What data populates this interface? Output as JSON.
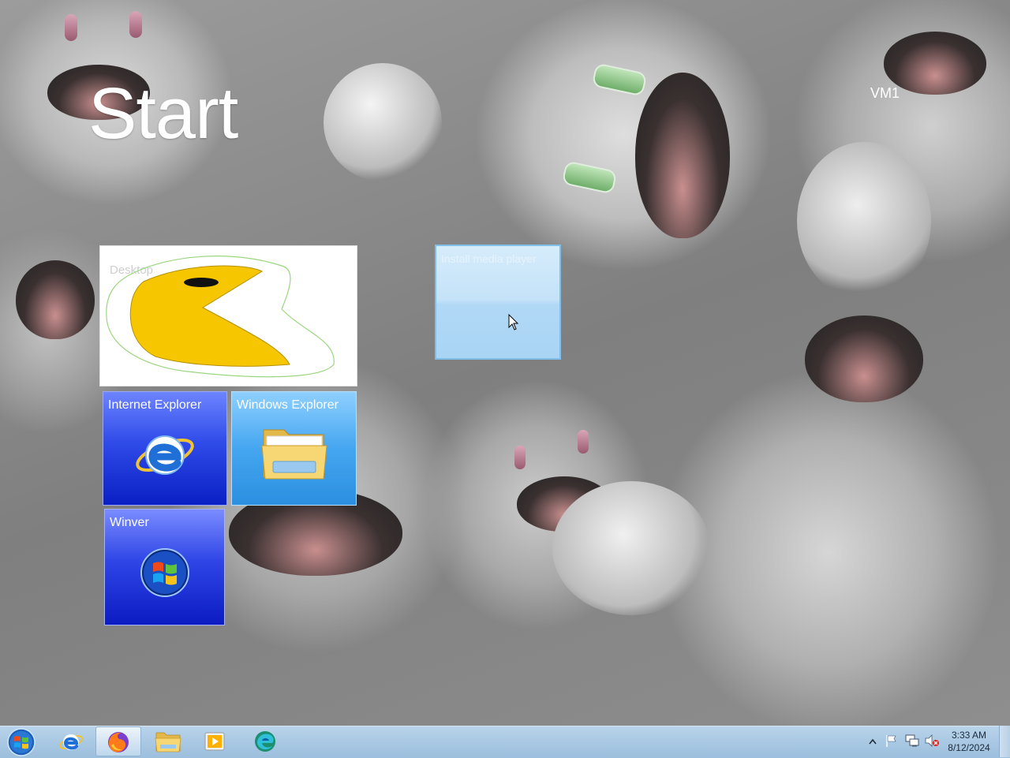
{
  "start_screen": {
    "title": "Start",
    "user_name": "VM1"
  },
  "tiles": {
    "desktop": {
      "label": "Desktop"
    },
    "internet_explorer": {
      "label": "Internet Explorer"
    },
    "windows_explorer": {
      "label": "Windows Explorer"
    },
    "winver": {
      "label": "Winver"
    },
    "placeholder": {
      "label": "Install media player"
    }
  },
  "taskbar": {
    "start_button_icon": "windows-orb-icon",
    "pinned": [
      {
        "name": "Internet Explorer",
        "icon": "ie-icon"
      },
      {
        "name": "Firefox",
        "icon": "firefox-icon",
        "active": true
      },
      {
        "name": "Windows Explorer",
        "icon": "folder-icon"
      },
      {
        "name": "Media Player",
        "icon": "media-player-icon"
      },
      {
        "name": "Edge",
        "icon": "edge-icon"
      }
    ],
    "tray": {
      "icons": [
        "show-hidden-icons-icon",
        "action-center-flag-icon",
        "network-icon",
        "volume-muted-icon"
      ],
      "time": "3:33 AM",
      "date": "8/12/2024"
    }
  },
  "colors": {
    "ie_tile": "#2f4be8",
    "explorer_tile": "#45a6f0",
    "winver_tile": "#2f45e6",
    "taskbar": "#a9c8e3",
    "pacman_yellow": "#f6c700"
  }
}
